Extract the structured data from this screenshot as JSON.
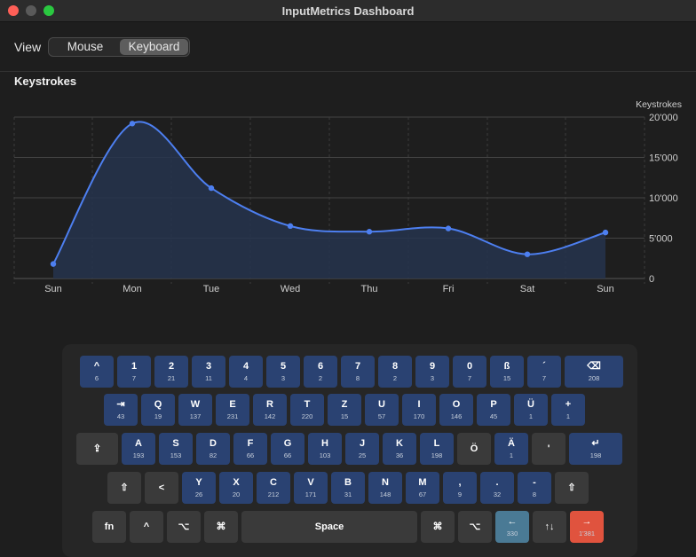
{
  "window": {
    "title": "InputMetrics Dashboard"
  },
  "view": {
    "label": "View",
    "options": [
      "Mouse",
      "Keyboard"
    ],
    "selected": "Keyboard"
  },
  "chart_section": {
    "title": "Keystrokes"
  },
  "chart_data": {
    "type": "line",
    "title": "Keystrokes",
    "ylabel": "Keystrokes",
    "categories": [
      "Sun",
      "Mon",
      "Tue",
      "Wed",
      "Thu",
      "Fri",
      "Sat",
      "Sun"
    ],
    "values": [
      1800,
      19200,
      11200,
      6500,
      5800,
      6200,
      3000,
      5700
    ],
    "ylim": [
      0,
      20000
    ],
    "yticks": [
      "0",
      "5'000",
      "10'000",
      "15'000",
      "20'000"
    ],
    "area_fill": true,
    "colors": {
      "line": "#4d7ff0",
      "fill": "#26344d",
      "grid": "#444444"
    }
  },
  "keyboard": {
    "rows": [
      [
        {
          "label": "^",
          "count": "6"
        },
        {
          "label": "1",
          "count": "7"
        },
        {
          "label": "2",
          "count": "21"
        },
        {
          "label": "3",
          "count": "11"
        },
        {
          "label": "4",
          "count": "4"
        },
        {
          "label": "5",
          "count": "3"
        },
        {
          "label": "6",
          "count": "2"
        },
        {
          "label": "7",
          "count": "8"
        },
        {
          "label": "8",
          "count": "2"
        },
        {
          "label": "9",
          "count": "3"
        },
        {
          "label": "0",
          "count": "7"
        },
        {
          "label": "ß",
          "count": "15"
        },
        {
          "label": "´",
          "count": "7"
        },
        {
          "label": "⌫",
          "count": "208"
        }
      ],
      [
        {
          "label": "⇥",
          "count": "43"
        },
        {
          "label": "Q",
          "count": "19"
        },
        {
          "label": "W",
          "count": "137"
        },
        {
          "label": "E",
          "count": "231"
        },
        {
          "label": "R",
          "count": "142"
        },
        {
          "label": "T",
          "count": "220"
        },
        {
          "label": "Z",
          "count": "15"
        },
        {
          "label": "U",
          "count": "57"
        },
        {
          "label": "I",
          "count": "170"
        },
        {
          "label": "O",
          "count": "146"
        },
        {
          "label": "P",
          "count": "45"
        },
        {
          "label": "Ü",
          "count": "1"
        },
        {
          "label": "+",
          "count": "1"
        }
      ],
      [
        {
          "label": "⇪",
          "count": ""
        },
        {
          "label": "A",
          "count": "193"
        },
        {
          "label": "S",
          "count": "153"
        },
        {
          "label": "D",
          "count": "82"
        },
        {
          "label": "F",
          "count": "66"
        },
        {
          "label": "G",
          "count": "66"
        },
        {
          "label": "H",
          "count": "103"
        },
        {
          "label": "J",
          "count": "25"
        },
        {
          "label": "K",
          "count": "36"
        },
        {
          "label": "L",
          "count": "198"
        },
        {
          "label": "Ö",
          "count": ""
        },
        {
          "label": "Ä",
          "count": "1"
        },
        {
          "label": "'",
          "count": ""
        },
        {
          "label": "↵",
          "count": "198"
        }
      ],
      [
        {
          "label": "⇧",
          "count": ""
        },
        {
          "label": "<",
          "count": ""
        },
        {
          "label": "Y",
          "count": "26"
        },
        {
          "label": "X",
          "count": "20"
        },
        {
          "label": "C",
          "count": "212"
        },
        {
          "label": "V",
          "count": "171"
        },
        {
          "label": "B",
          "count": "31"
        },
        {
          "label": "N",
          "count": "148"
        },
        {
          "label": "M",
          "count": "67"
        },
        {
          "label": ",",
          "count": "9"
        },
        {
          "label": ".",
          "count": "32"
        },
        {
          "label": "-",
          "count": "8"
        },
        {
          "label": "⇧",
          "count": ""
        }
      ],
      [
        {
          "label": "fn",
          "count": ""
        },
        {
          "label": "^",
          "count": ""
        },
        {
          "label": "⌥",
          "count": ""
        },
        {
          "label": "⌘",
          "count": ""
        },
        {
          "label": "Space",
          "count": ""
        },
        {
          "label": "⌘",
          "count": ""
        },
        {
          "label": "⌥",
          "count": ""
        },
        {
          "label": "←",
          "count": "330"
        },
        {
          "label": "↑↓",
          "count": ""
        },
        {
          "label": "→",
          "count": "1'381"
        }
      ]
    ]
  }
}
